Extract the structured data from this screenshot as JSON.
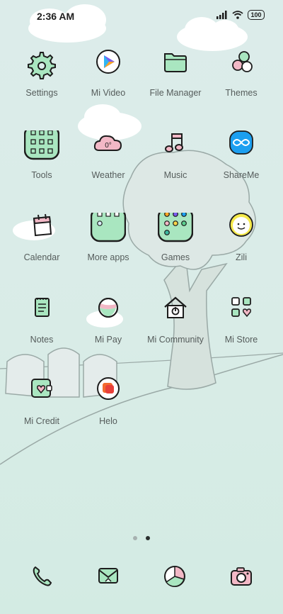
{
  "status_bar": {
    "time": "2:36 AM",
    "battery": "100",
    "icons": [
      "signal-icon",
      "wifi-icon",
      "battery-icon"
    ]
  },
  "apps": [
    {
      "label": "Settings",
      "icon": "gear-icon"
    },
    {
      "label": "Mi Video",
      "icon": "play-icon"
    },
    {
      "label": "File Manager",
      "icon": "folder-icon"
    },
    {
      "label": "Themes",
      "icon": "circles-icon"
    },
    {
      "label": "Tools",
      "icon": "folder-tools-icon"
    },
    {
      "label": "Weather",
      "icon": "cloud-temperature-icon",
      "temp": "0°"
    },
    {
      "label": "Music",
      "icon": "music-note-icon"
    },
    {
      "label": "ShareMe",
      "icon": "infinity-icon"
    },
    {
      "label": "Calendar",
      "icon": "calendar-icon"
    },
    {
      "label": "More apps",
      "icon": "folder-more-apps-icon"
    },
    {
      "label": "Games",
      "icon": "folder-games-icon"
    },
    {
      "label": "Zili",
      "icon": "smiley-icon"
    },
    {
      "label": "Notes",
      "icon": "notepad-icon"
    },
    {
      "label": "Mi Pay",
      "icon": "ball-icon"
    },
    {
      "label": "Mi Community",
      "icon": "house-power-icon"
    },
    {
      "label": "Mi Store",
      "icon": "tiles-heart-icon"
    },
    {
      "label": "Mi Credit",
      "icon": "wallet-heart-icon"
    },
    {
      "label": "Helo",
      "icon": "helo-icon"
    }
  ],
  "page_indicator": {
    "count": 2,
    "active": 2
  },
  "dock": [
    {
      "icon": "phone-icon"
    },
    {
      "icon": "message-icon"
    },
    {
      "icon": "browser-icon"
    },
    {
      "icon": "camera-icon"
    }
  ],
  "colors": {
    "background": "#dcecea",
    "mint": "#a9e6c0",
    "pink": "#f2b8c6",
    "outline": "#1d1d1d",
    "label": "#555c5b",
    "share_blue": "#1c9ff0"
  }
}
